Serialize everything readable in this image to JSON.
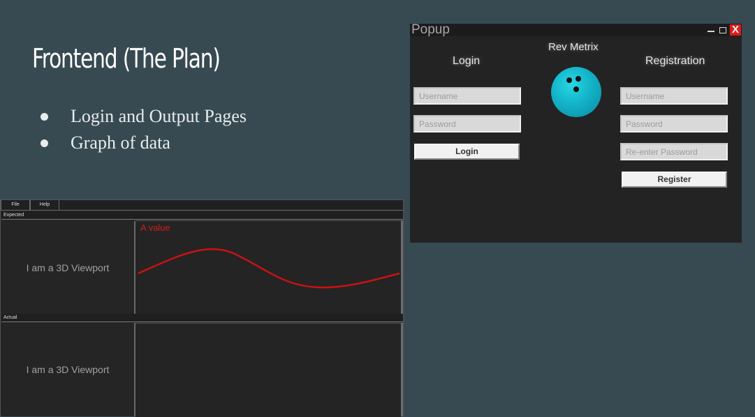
{
  "slide": {
    "title": "Frontend (The Plan)",
    "bullets": [
      "Login and Output Pages",
      "Graph of data"
    ]
  },
  "popup": {
    "title": "Popup",
    "window_controls": {
      "minimize": "minimize-icon",
      "restore": "restore-icon",
      "close": "X"
    },
    "brand": "Rev Metrix",
    "login": {
      "heading": "Login",
      "username_placeholder": "Username",
      "password_placeholder": "Password",
      "button": "Login"
    },
    "registration": {
      "heading": "Registration",
      "username_placeholder": "Username",
      "password_placeholder": "Password",
      "reenter_placeholder": "Re-enter Password",
      "button": "Register"
    },
    "logo_icon": "bowling-ball-icon"
  },
  "app": {
    "menu": [
      "File",
      "Help"
    ],
    "sections": [
      {
        "label": "Expected",
        "viewport_text": "I am a 3D Viewport",
        "graph_label": "A value"
      },
      {
        "label": "Actual",
        "viewport_text": "I am a 3D Viewport",
        "graph_label": ""
      }
    ],
    "curve_color": "#cc1111"
  },
  "colors": {
    "background": "#374a52",
    "popup_bg": "#232323",
    "close_button": "#e21b1b",
    "ball": "#13b3c8"
  }
}
